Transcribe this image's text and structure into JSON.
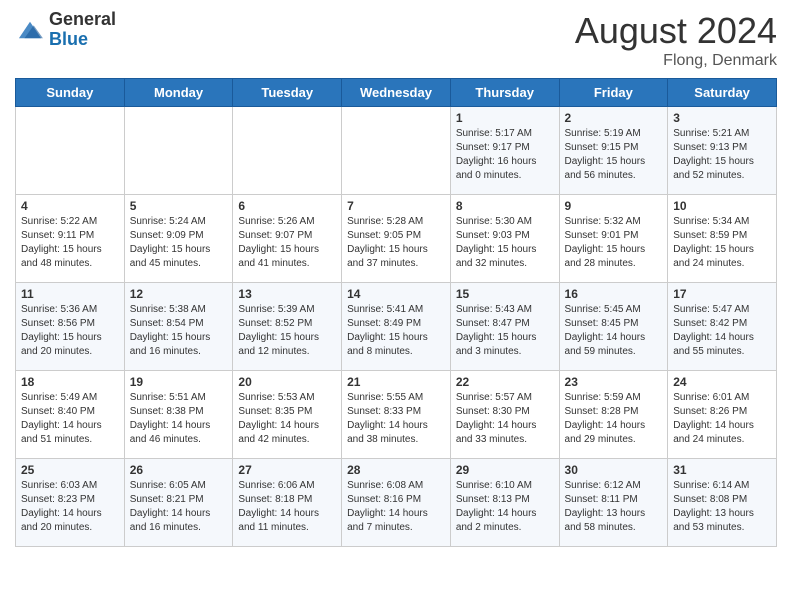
{
  "header": {
    "logo_general": "General",
    "logo_blue": "Blue",
    "month_year": "August 2024",
    "location": "Flong, Denmark"
  },
  "weekdays": [
    "Sunday",
    "Monday",
    "Tuesday",
    "Wednesday",
    "Thursday",
    "Friday",
    "Saturday"
  ],
  "weeks": [
    [
      {
        "day": "",
        "info": ""
      },
      {
        "day": "",
        "info": ""
      },
      {
        "day": "",
        "info": ""
      },
      {
        "day": "",
        "info": ""
      },
      {
        "day": "1",
        "info": "Sunrise: 5:17 AM\nSunset: 9:17 PM\nDaylight: 16 hours\nand 0 minutes."
      },
      {
        "day": "2",
        "info": "Sunrise: 5:19 AM\nSunset: 9:15 PM\nDaylight: 15 hours\nand 56 minutes."
      },
      {
        "day": "3",
        "info": "Sunrise: 5:21 AM\nSunset: 9:13 PM\nDaylight: 15 hours\nand 52 minutes."
      }
    ],
    [
      {
        "day": "4",
        "info": "Sunrise: 5:22 AM\nSunset: 9:11 PM\nDaylight: 15 hours\nand 48 minutes."
      },
      {
        "day": "5",
        "info": "Sunrise: 5:24 AM\nSunset: 9:09 PM\nDaylight: 15 hours\nand 45 minutes."
      },
      {
        "day": "6",
        "info": "Sunrise: 5:26 AM\nSunset: 9:07 PM\nDaylight: 15 hours\nand 41 minutes."
      },
      {
        "day": "7",
        "info": "Sunrise: 5:28 AM\nSunset: 9:05 PM\nDaylight: 15 hours\nand 37 minutes."
      },
      {
        "day": "8",
        "info": "Sunrise: 5:30 AM\nSunset: 9:03 PM\nDaylight: 15 hours\nand 32 minutes."
      },
      {
        "day": "9",
        "info": "Sunrise: 5:32 AM\nSunset: 9:01 PM\nDaylight: 15 hours\nand 28 minutes."
      },
      {
        "day": "10",
        "info": "Sunrise: 5:34 AM\nSunset: 8:59 PM\nDaylight: 15 hours\nand 24 minutes."
      }
    ],
    [
      {
        "day": "11",
        "info": "Sunrise: 5:36 AM\nSunset: 8:56 PM\nDaylight: 15 hours\nand 20 minutes."
      },
      {
        "day": "12",
        "info": "Sunrise: 5:38 AM\nSunset: 8:54 PM\nDaylight: 15 hours\nand 16 minutes."
      },
      {
        "day": "13",
        "info": "Sunrise: 5:39 AM\nSunset: 8:52 PM\nDaylight: 15 hours\nand 12 minutes."
      },
      {
        "day": "14",
        "info": "Sunrise: 5:41 AM\nSunset: 8:49 PM\nDaylight: 15 hours\nand 8 minutes."
      },
      {
        "day": "15",
        "info": "Sunrise: 5:43 AM\nSunset: 8:47 PM\nDaylight: 15 hours\nand 3 minutes."
      },
      {
        "day": "16",
        "info": "Sunrise: 5:45 AM\nSunset: 8:45 PM\nDaylight: 14 hours\nand 59 minutes."
      },
      {
        "day": "17",
        "info": "Sunrise: 5:47 AM\nSunset: 8:42 PM\nDaylight: 14 hours\nand 55 minutes."
      }
    ],
    [
      {
        "day": "18",
        "info": "Sunrise: 5:49 AM\nSunset: 8:40 PM\nDaylight: 14 hours\nand 51 minutes."
      },
      {
        "day": "19",
        "info": "Sunrise: 5:51 AM\nSunset: 8:38 PM\nDaylight: 14 hours\nand 46 minutes."
      },
      {
        "day": "20",
        "info": "Sunrise: 5:53 AM\nSunset: 8:35 PM\nDaylight: 14 hours\nand 42 minutes."
      },
      {
        "day": "21",
        "info": "Sunrise: 5:55 AM\nSunset: 8:33 PM\nDaylight: 14 hours\nand 38 minutes."
      },
      {
        "day": "22",
        "info": "Sunrise: 5:57 AM\nSunset: 8:30 PM\nDaylight: 14 hours\nand 33 minutes."
      },
      {
        "day": "23",
        "info": "Sunrise: 5:59 AM\nSunset: 8:28 PM\nDaylight: 14 hours\nand 29 minutes."
      },
      {
        "day": "24",
        "info": "Sunrise: 6:01 AM\nSunset: 8:26 PM\nDaylight: 14 hours\nand 24 minutes."
      }
    ],
    [
      {
        "day": "25",
        "info": "Sunrise: 6:03 AM\nSunset: 8:23 PM\nDaylight: 14 hours\nand 20 minutes."
      },
      {
        "day": "26",
        "info": "Sunrise: 6:05 AM\nSunset: 8:21 PM\nDaylight: 14 hours\nand 16 minutes."
      },
      {
        "day": "27",
        "info": "Sunrise: 6:06 AM\nSunset: 8:18 PM\nDaylight: 14 hours\nand 11 minutes."
      },
      {
        "day": "28",
        "info": "Sunrise: 6:08 AM\nSunset: 8:16 PM\nDaylight: 14 hours\nand 7 minutes."
      },
      {
        "day": "29",
        "info": "Sunrise: 6:10 AM\nSunset: 8:13 PM\nDaylight: 14 hours\nand 2 minutes."
      },
      {
        "day": "30",
        "info": "Sunrise: 6:12 AM\nSunset: 8:11 PM\nDaylight: 13 hours\nand 58 minutes."
      },
      {
        "day": "31",
        "info": "Sunrise: 6:14 AM\nSunset: 8:08 PM\nDaylight: 13 hours\nand 53 minutes."
      }
    ]
  ]
}
